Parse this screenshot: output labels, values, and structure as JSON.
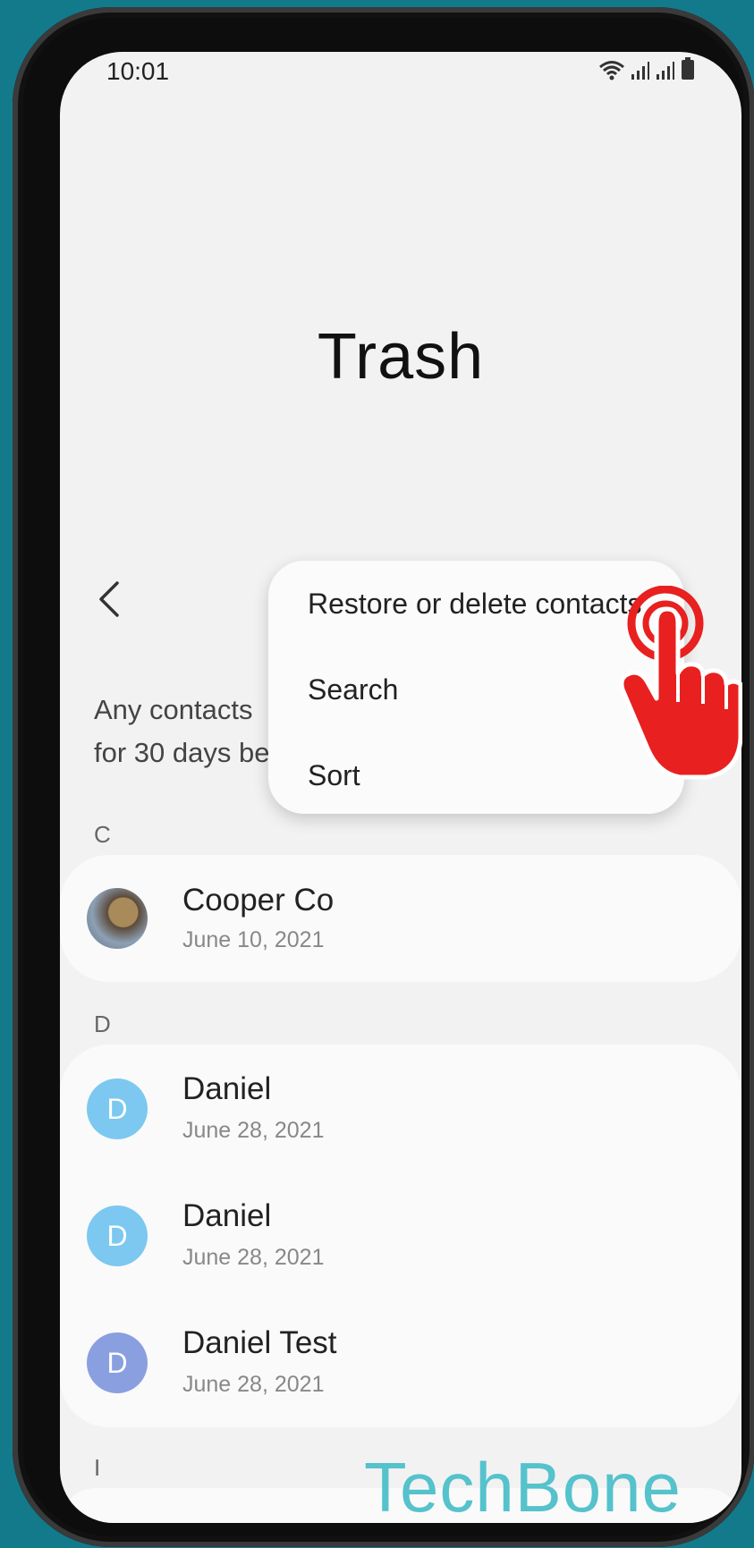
{
  "status_bar": {
    "time": "10:01",
    "icons": [
      "wifi-icon",
      "signal-icon",
      "signal-icon",
      "battery-icon"
    ]
  },
  "page": {
    "title": "Trash"
  },
  "info_text": "Any contacts\nfor 30 days be",
  "menu": {
    "items": [
      {
        "label": "Restore or delete contacts"
      },
      {
        "label": "Search"
      },
      {
        "label": "Sort"
      }
    ]
  },
  "sections": [
    {
      "letter": "C",
      "contacts": [
        {
          "name": "Cooper Co",
          "date": "June 10, 2021",
          "avatar": "photo"
        }
      ]
    },
    {
      "letter": "D",
      "contacts": [
        {
          "name": "Daniel",
          "date": "June 28, 2021",
          "avatar": "D",
          "avatar_color": "#7cc8f0"
        },
        {
          "name": "Daniel",
          "date": "June 28, 2021",
          "avatar": "D",
          "avatar_color": "#7cc8f0"
        },
        {
          "name": "Daniel Test",
          "date": "June 28, 2021",
          "avatar": "D",
          "avatar_color": "#8a9fe0"
        }
      ]
    },
    {
      "letter": "I",
      "contacts": []
    }
  ],
  "watermark": "TechBone",
  "colors": {
    "background": "#137a8c",
    "tap_hand": "#e8201f",
    "watermark": "#55c2cc"
  }
}
